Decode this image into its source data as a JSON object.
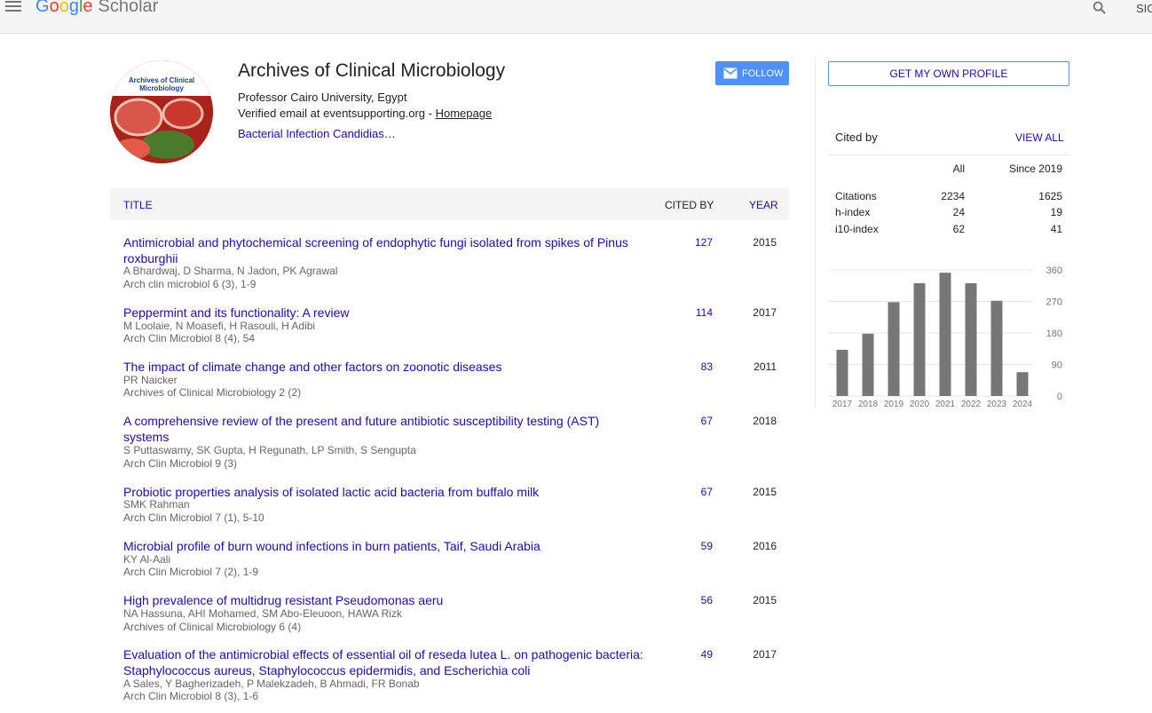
{
  "header": {
    "logo_letters": [
      "G",
      "o",
      "o",
      "g",
      "l",
      "e"
    ],
    "logo_suffix": "Scholar",
    "sign_in": "SIG"
  },
  "profile": {
    "name": "Archives of Clinical Microbiology",
    "affiliation": "Professor Cairo University, Egypt",
    "email_text": "Verified email at eventsupporting.org - ",
    "homepage": "Homepage",
    "interests": "Bacterial Infection Candidias…",
    "follow_label": "FOLLOW",
    "avatar_caption": "Archives of Clinical Microbiology"
  },
  "table": {
    "col_title": "TITLE",
    "col_cited": "CITED BY",
    "col_year": "YEAR",
    "rows": [
      {
        "title": "Antimicrobial and phytochemical screening of endophytic fungi isolated from spikes of Pinus roxburghii",
        "authors": "A Bhardwaj, D Sharma, N Jadon, PK Agrawal",
        "venue": "Arch clin microbiol 6 (3), 1-9",
        "cited": "127",
        "year": "2015"
      },
      {
        "title": "Peppermint and its functionality: A review",
        "authors": "M Loolaie, N Moasefi, H Rasouli, H Adibi",
        "venue": "Arch Clin Microbiol 8 (4), 54",
        "cited": "114",
        "year": "2017"
      },
      {
        "title": "The impact of climate change and other factors on zoonotic diseases",
        "authors": "PR Naicker",
        "venue": "Archives of Clinical Microbiology 2 (2)",
        "cited": "83",
        "year": "2011"
      },
      {
        "title": "A comprehensive review of the present and future antibiotic susceptibility testing (AST) systems",
        "authors": "S Puttaswamy, SK Gupta, H Regunath, LP Smith, S Sengupta",
        "venue": "Arch Clin Microbiol 9 (3)",
        "cited": "67",
        "year": "2018"
      },
      {
        "title": "Probiotic properties analysis of isolated lactic acid bacteria from buffalo milk",
        "authors": "SMK Rahman",
        "venue": "Arch Clin Microbiol 7 (1), 5-10",
        "cited": "67",
        "year": "2015"
      },
      {
        "title": "Microbial profile of burn wound infections in burn patients, Taif, Saudi Arabia",
        "authors": "KY Al-Aali",
        "venue": "Arch Clin Microbiol 7 (2), 1-9",
        "cited": "59",
        "year": "2016"
      },
      {
        "title": "High prevalence of multidrug resistant Pseudomonas aeru",
        "authors": "NA Hassuna, AHI Mohamed, SM Abo-Eleuoon, HAWA Rizk",
        "venue": "Archives of Clinical Microbiology 6 (4)",
        "cited": "56",
        "year": "2015"
      },
      {
        "title": "Evaluation of the antimicrobial effects of essential oil of reseda lutea L. on pathogenic bacteria: Staphylococcus aureus, Staphylococcus epidermidis, and Escherichia coli",
        "authors": "A Sales, Y Bagherizadeh, P Malekzadeh, B Ahmadi, FR Bonab",
        "venue": "Arch Clin Microbiol 8 (3), 1-6",
        "cited": "49",
        "year": "2017"
      }
    ]
  },
  "sidebar": {
    "get_profile": "GET MY OWN PROFILE",
    "cited_by": "Cited by",
    "view_all": "VIEW ALL",
    "col_all": "All",
    "col_since": "Since 2019",
    "stats": [
      {
        "label": "Citations",
        "all": "2234",
        "since": "1625"
      },
      {
        "label": "h-index",
        "all": "24",
        "since": "19"
      },
      {
        "label": "i10-index",
        "all": "62",
        "since": "41"
      }
    ]
  },
  "chart_data": {
    "type": "bar",
    "categories": [
      "2017",
      "2018",
      "2019",
      "2020",
      "2021",
      "2022",
      "2023",
      "2024"
    ],
    "values": [
      132,
      178,
      268,
      322,
      352,
      322,
      272,
      68
    ],
    "y_ticks": [
      "360",
      "270",
      "180",
      "90",
      "0"
    ],
    "ylim": [
      0,
      360
    ],
    "bar_color": "#777777",
    "grid": true
  }
}
